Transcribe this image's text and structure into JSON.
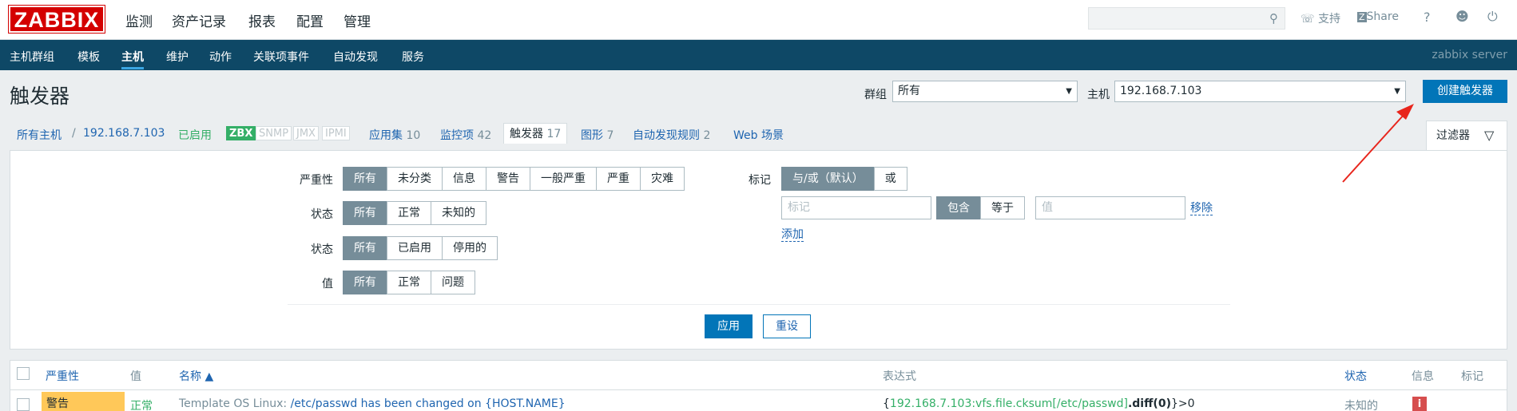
{
  "logo": "ZABBIX",
  "main_menu": [
    "监测",
    "资产记录",
    "报表",
    "配置",
    "管理"
  ],
  "top": {
    "support": "支持",
    "share": "Share",
    "help": "?",
    "user_icon": "user-icon",
    "power_icon": "power-icon",
    "search_placeholder": ""
  },
  "sub_menu": [
    "主机群组",
    "模板",
    "主机",
    "维护",
    "动作",
    "关联项事件",
    "自动发现",
    "服务"
  ],
  "server": "zabbix server",
  "page_title": "触发器",
  "group_label": "群组",
  "group_value": "所有",
  "host_label": "主机",
  "host_value": "192.168.7.103",
  "create_button": "创建触发器",
  "breadcrumb": {
    "all_hosts": "所有主机",
    "sep": "/",
    "host": "192.168.7.103",
    "status": "已启用"
  },
  "availability": [
    "ZBX",
    "SNMP",
    "JMX",
    "IPMI"
  ],
  "host_links": [
    {
      "label": "应用集",
      "count": "10"
    },
    {
      "label": "监控项",
      "count": "42"
    },
    {
      "label": "触发器",
      "count": "17"
    },
    {
      "label": "图形",
      "count": "7"
    },
    {
      "label": "自动发现规则",
      "count": "2"
    },
    {
      "label": "Web 场景",
      "count": ""
    }
  ],
  "filter_tab": "过滤器",
  "filter": {
    "severity_label": "严重性",
    "severity": [
      "所有",
      "未分类",
      "信息",
      "警告",
      "一般严重",
      "严重",
      "灾难"
    ],
    "state_label": "状态",
    "state": [
      "所有",
      "正常",
      "未知的"
    ],
    "status_label": "状态",
    "status": [
      "所有",
      "已启用",
      "停用的"
    ],
    "value_label": "值",
    "value": [
      "所有",
      "正常",
      "问题"
    ],
    "tags_label": "标记",
    "tags_mode": [
      "与/或（默认）",
      "或"
    ],
    "tag_placeholder": "标记",
    "tag_op": [
      "包含",
      "等于"
    ],
    "value_placeholder": "值",
    "remove": "移除",
    "add": "添加",
    "apply": "应用",
    "reset": "重设"
  },
  "table": {
    "headers": {
      "severity": "严重性",
      "value": "值",
      "name": "名称 ▲",
      "expression": "表达式",
      "status": "状态",
      "info": "信息",
      "tags": "标记"
    },
    "rows": [
      {
        "severity": "警告",
        "value": "正常",
        "template": "Template OS Linux: ",
        "name": "/etc/passwd has been changed on {HOST.NAME}",
        "expr_open": "{",
        "expr_item": "192.168.7.103:vfs.file.cksum[/etc/passwd]",
        "expr_fn": ".diff(0)",
        "expr_tail": "}>0",
        "status": "未知的",
        "info": "i"
      }
    ]
  },
  "colors": {
    "header_bg": "#0e4866",
    "primary": "#0275b8",
    "logo": "#d40000",
    "warning": "#ffc859",
    "ok": "#34af67",
    "arrow": "#e8251c"
  }
}
